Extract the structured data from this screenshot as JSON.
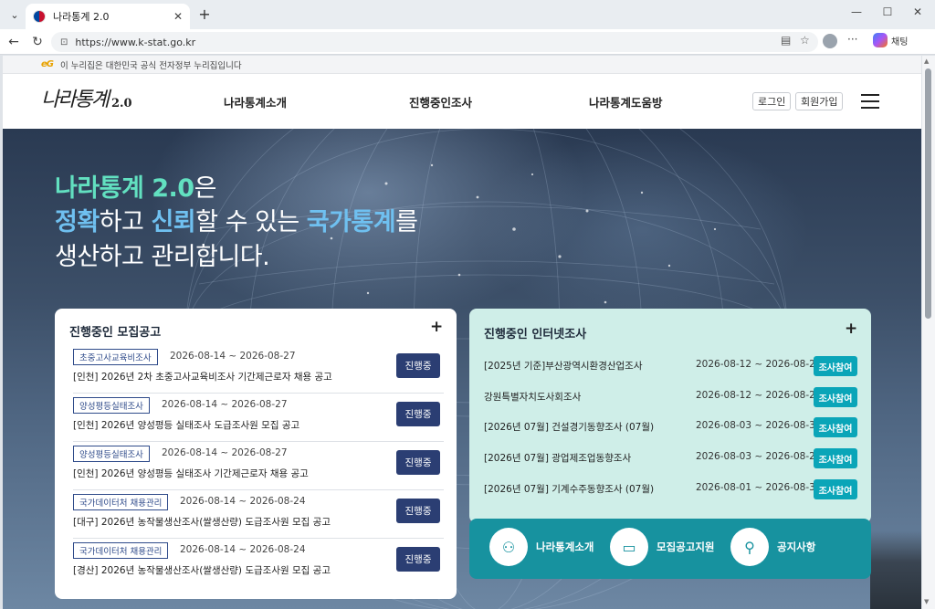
{
  "browser": {
    "tab_title": "나라통계 2.0",
    "url": "https://www.k-stat.go.kr",
    "copilot_label": "채팅"
  },
  "gov_banner": {
    "logo": "eG",
    "text": "이 누리집은 대한민국 공식 전자정부 누리집입니다"
  },
  "header": {
    "logo_main": "나라통계",
    "logo_version": "2.0",
    "nav": [
      "나라통계소개",
      "진행중인조사",
      "나라통계도움방"
    ],
    "login": "로그인",
    "signup": "회원가입"
  },
  "hero": {
    "line1_a": "나라통계 2.0",
    "line1_b": "은",
    "line2_a": "정확",
    "line2_b": "하고 ",
    "line2_c": "신뢰",
    "line2_d": "할 수 있는 ",
    "line2_e": "국가통계",
    "line2_f": "를",
    "line3": "생산하고 관리합니다."
  },
  "notices": {
    "title": "진행중인 모집공고",
    "more": "+",
    "items": [
      {
        "category": "초중고사교육비조사",
        "date": "2026-08-14 ~ 2026-08-27",
        "title": "[인천] 2026년 2차 초중고사교육비조사 기간제근로자 채용 공고",
        "status": "진행중"
      },
      {
        "category": "양성평등실태조사",
        "date": "2026-08-14 ~ 2026-08-27",
        "title": "[인천] 2026년 양성평등 실태조사 도급조사원 모집 공고",
        "status": "진행중"
      },
      {
        "category": "양성평등실태조사",
        "date": "2026-08-14 ~ 2026-08-27",
        "title": "[인천] 2026년 양성평등 실태조사 기간제근로자 채용 공고",
        "status": "진행중"
      },
      {
        "category": "국가데이터처 채용관리",
        "date": "2026-08-14 ~ 2026-08-24",
        "title": "[대구] 2026년 농작물생산조사(쌀생산량) 도급조사원 모집 공고",
        "status": "진행중"
      },
      {
        "category": "국가데이터처 채용관리",
        "date": "2026-08-14 ~ 2026-08-24",
        "title": "[경산] 2026년 농작물생산조사(쌀생산량) 도급조사원 모집 공고",
        "status": "진행중"
      }
    ]
  },
  "surveys": {
    "title": "진행중인 인터넷조사",
    "more": "+",
    "items": [
      {
        "name": "[2025년 기준]부산광역시환경산업조사",
        "date": "2026-08-12 ~ 2026-08-26",
        "action": "조사참여"
      },
      {
        "name": "강원특별자치도사회조사",
        "date": "2026-08-12 ~ 2026-08-29",
        "action": "조사참여"
      },
      {
        "name": "[2026년 07월] 건설경기동향조사 (07월)",
        "date": "2026-08-03 ~ 2026-08-31",
        "action": "조사참여"
      },
      {
        "name": "[2026년 07월] 광업제조업동향조사",
        "date": "2026-08-03 ~ 2026-08-21",
        "action": "조사참여"
      },
      {
        "name": "[2026년 07월] 기계수주동향조사 (07월)",
        "date": "2026-08-01 ~ 2026-08-31",
        "action": "조사참여"
      }
    ]
  },
  "quick_links": [
    {
      "label": "나라통계소개",
      "icon": "people-icon"
    },
    {
      "label": "모집공고지원",
      "icon": "id-badge-icon"
    },
    {
      "label": "공지사항",
      "icon": "location-pin-icon"
    }
  ],
  "colors": {
    "accent_mint": "#62e0c0",
    "accent_sky": "#6fc0f0",
    "status_navy": "#2b3e73",
    "survey_teal": "#0aa5b8",
    "quick_bar": "#17929f",
    "survey_card_bg": "#cfeee8"
  }
}
